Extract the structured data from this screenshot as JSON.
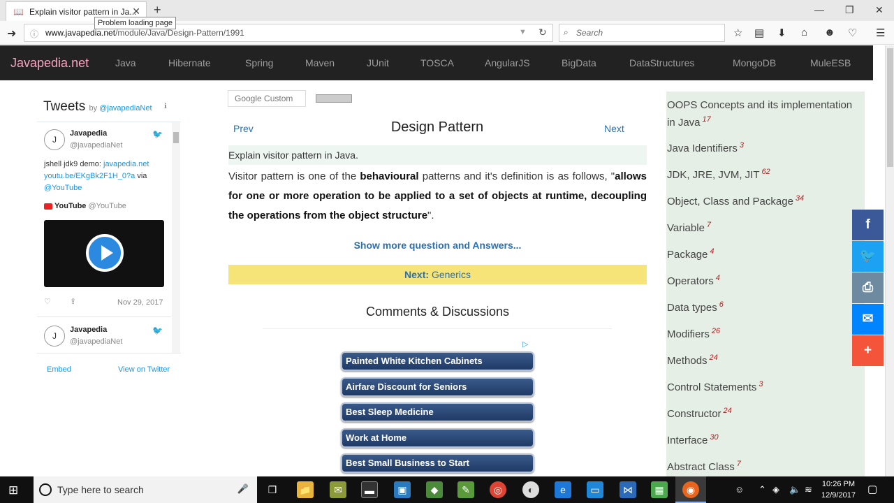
{
  "browser": {
    "tab_title": "Explain visitor pattern in Ja...",
    "tooltip": "Problem loading page",
    "url_domain": "www.javapedia.net",
    "url_path": "/module/Java/Design-Pattern/1991",
    "search_placeholder": "Search"
  },
  "site": {
    "logo": "Javapedia.net",
    "nav": [
      "Java",
      "Hibernate",
      "Spring",
      "Maven",
      "JUnit",
      "TOSCA",
      "AngularJS",
      "BigData",
      "DataStructures",
      "MongoDB",
      "MuleESB"
    ]
  },
  "twitter": {
    "title": "Tweets",
    "by": "by",
    "by_handle": "@javapediaNet",
    "tweet1": {
      "name": "Javapedia",
      "handle": "@javapediaNet",
      "text_prefix": "jshell jdk9 demo: ",
      "link1": "javapedia.net",
      "link2": "youtu.be/EKgBk2F1H_0?a",
      "text_mid": " via",
      "link3": "@YouTube",
      "yt_name": "YouTube",
      "yt_handle": "@YouTube",
      "date": "Nov 29, 2017"
    },
    "tweet2": {
      "name": "Javapedia",
      "handle": "@javapediaNet"
    },
    "embed": "Embed",
    "view_on_twitter": "View on Twitter"
  },
  "content": {
    "google_search": "Google Custom",
    "prev": "Prev",
    "next": "Next",
    "title": "Design Pattern",
    "question": "Explain visitor pattern in Java.",
    "body_1": "Visitor pattern is one of the ",
    "body_bold1": "behavioural",
    "body_2": " patterns and it's definition is as follows, \"",
    "body_bold2": "allows for one or more operation to be applied to a set of objects at runtime, decoupling the operations from the object structure",
    "body_3": "\".",
    "show_more": "Show more question and Answers...",
    "next_label": "Next:",
    "next_topic": "Generics",
    "comments": "Comments & Discussions",
    "ads": [
      "Painted White Kitchen Cabinets",
      "Airfare Discount for Seniors",
      "Best Sleep Medicine",
      "Work at Home",
      "Best Small Business to Start"
    ]
  },
  "sidebar": {
    "items": [
      {
        "label": "OOPS Concepts and its implementation in Java",
        "count": "17"
      },
      {
        "label": "Java Identifiers",
        "count": "3"
      },
      {
        "label": "JDK, JRE, JVM, JIT",
        "count": "62"
      },
      {
        "label": "Object, Class and Package",
        "count": "34"
      },
      {
        "label": "Variable",
        "count": "7"
      },
      {
        "label": "Package",
        "count": "4"
      },
      {
        "label": "Operators",
        "count": "4"
      },
      {
        "label": "Data types",
        "count": "6"
      },
      {
        "label": "Modifiers",
        "count": "26"
      },
      {
        "label": "Methods",
        "count": "24"
      },
      {
        "label": "Control Statements",
        "count": "3"
      },
      {
        "label": "Constructor",
        "count": "24"
      },
      {
        "label": "Interface",
        "count": "30"
      },
      {
        "label": "Abstract Class",
        "count": "7"
      }
    ]
  },
  "share": {
    "icons": [
      "facebook-icon",
      "twitter-icon",
      "print-icon",
      "messenger-icon",
      "plus-icon"
    ],
    "colors": [
      "#3b5998",
      "#1da1f2",
      "#6d8aa0",
      "#0084ff",
      "#f4553a"
    ]
  },
  "taskbar": {
    "search_placeholder": "Type here to search",
    "time": "10:26 PM",
    "date": "12/9/2017"
  }
}
